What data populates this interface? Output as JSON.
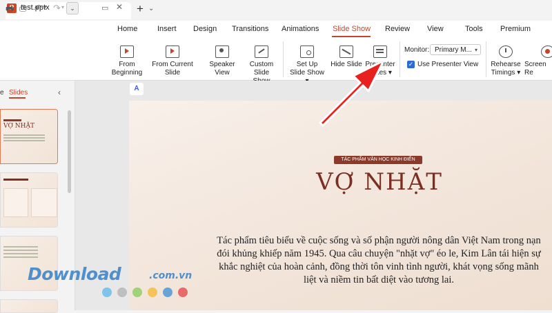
{
  "app": {
    "tab_logo": "P",
    "tab_title": "test.pptx",
    "monitor_glyph": "▭",
    "close_glyph": "✕",
    "new_tab_glyph": "+",
    "tab_list_glyph": "⌄"
  },
  "quick_access": {
    "print": "🖶",
    "print_preview": "⎙",
    "undo": "↶",
    "undo_menu": "▾",
    "redo": "↷",
    "redo_menu": "▾",
    "more": "⌄"
  },
  "menu": {
    "items": [
      "Home",
      "Insert",
      "Design",
      "Transitions",
      "Animations",
      "Slide Show",
      "Review",
      "View",
      "Tools",
      "Premium"
    ],
    "active": "Slide Show"
  },
  "ribbon": {
    "from_beginning": [
      "From",
      "Beginning"
    ],
    "from_current": [
      "From Current Slide"
    ],
    "speaker_view": [
      "Speaker View"
    ],
    "custom_show": [
      "Custom",
      "Slide Show"
    ],
    "setup_show": [
      "Set Up",
      "Slide Show ▾"
    ],
    "hide_slide": [
      "Hide Slide"
    ],
    "presenter_notes": [
      "Presenter",
      "Notes ▾"
    ],
    "monitor_label": "Monitor:",
    "monitor_value": "Primary M...",
    "monitor_caret": "▾",
    "use_presenter_view": "Use Presenter View",
    "use_presenter_checked": true,
    "check_glyph": "✓",
    "rehearse": [
      "Rehearse",
      "Timings ▾"
    ],
    "screen_rec": [
      "Screen Re"
    ]
  },
  "left_panel": {
    "outline_tab": "e",
    "slides_tab": "Slides",
    "collapse_glyph": "‹",
    "thumb1_title": "VỢ NHẶT"
  },
  "slide": {
    "ai_badge": "A",
    "tag": "TÁC PHẨM VĂN HỌC KINH ĐIỂN",
    "title": "VỢ NHẶT",
    "body": "Tác phẩm tiêu biểu về cuộc sống và số phận người nông dân Việt Nam trong nạn đói khủng khiếp năm 1945. Qua câu chuyện \"nhặt vợ\" éo le, Kim Lân tái hiện sự khắc nghiệt của hoàn cảnh, đồng thời tôn vinh tình người, khát vọng sống mãnh liệt và niềm tin bất diệt vào tương lai."
  },
  "watermark": {
    "name": "Download",
    "suffix": ".com.vn",
    "dots": [
      "#7fc4ea",
      "#bfbfbf",
      "#9fd27a",
      "#f6c25a",
      "#6aa4d6",
      "#e96a6a"
    ]
  },
  "colors": {
    "accent": "#c4452d",
    "arrow": "#e8211e",
    "checkbox": "#2b6cd4"
  }
}
